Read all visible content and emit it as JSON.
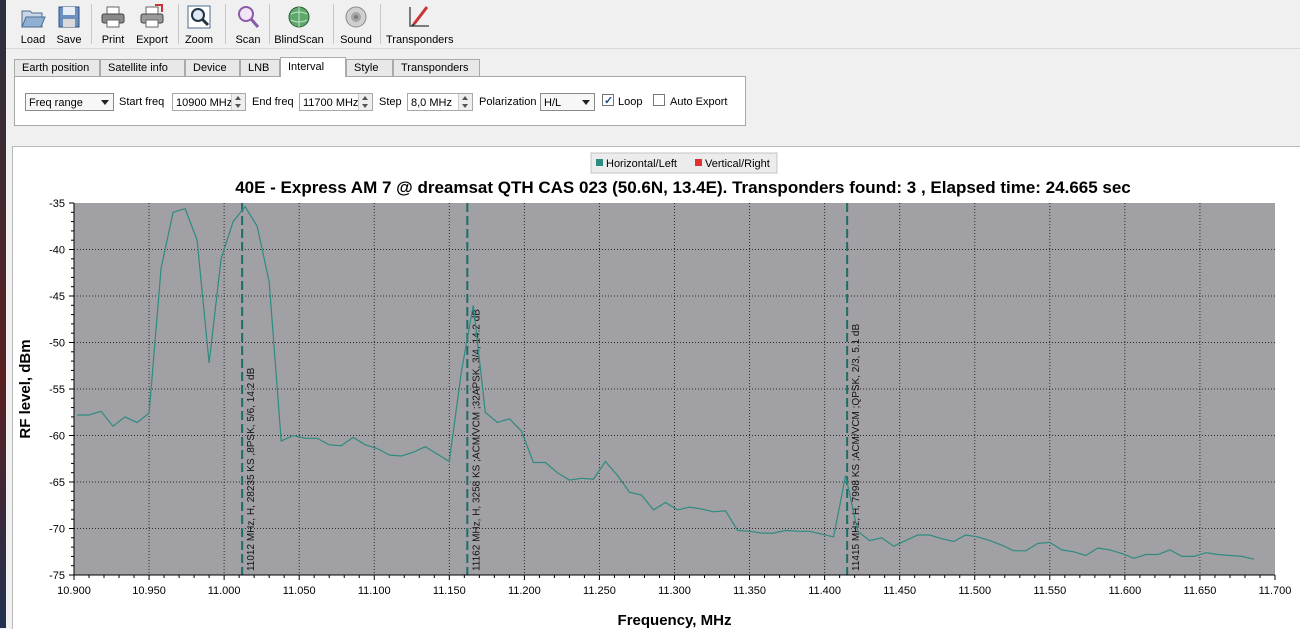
{
  "toolbar": {
    "buttons": [
      {
        "label": "Load",
        "icon": "folder-open-icon"
      },
      {
        "label": "Save",
        "icon": "floppy-disk-icon"
      },
      {
        "label": "Print",
        "icon": "printer-icon"
      },
      {
        "label": "Export",
        "icon": "export-printer-icon"
      },
      {
        "label": "Zoom",
        "icon": "magnifier-icon"
      },
      {
        "label": "Scan",
        "icon": "scan-magnifier-icon"
      },
      {
        "label": "BlindScan",
        "icon": "globe-icon"
      },
      {
        "label": "Sound",
        "icon": "speaker-icon"
      },
      {
        "label": "Transponders",
        "icon": "pencil-chart-icon"
      }
    ]
  },
  "tabs": [
    "Earth position",
    "Satellite info",
    "Device",
    "LNB",
    "Interval",
    "Style",
    "Transponders"
  ],
  "active_tab": "Interval",
  "interval": {
    "mode_select": "Freq range",
    "start_freq_label": "Start freq",
    "start_freq_value": "10900 MHz",
    "end_freq_label": "End freq",
    "end_freq_value": "11700 MHz",
    "step_label": "Step",
    "step_value": "8,0 MHz",
    "polarization_label": "Polarization",
    "polarization_value": "H/L",
    "loop_label": "Loop",
    "loop_checked": true,
    "auto_export_label": "Auto Export",
    "auto_export_checked": false
  },
  "chart_data": {
    "type": "line",
    "title": "40E - Express AM 7 @ dreamsat QTH CAS 023 (50.6N, 13.4E). Transponders found: 3 , Elapsed time: 24.665 sec",
    "xlabel": "Frequency, MHz",
    "ylabel": "RF level, dBm",
    "xlim": [
      10900,
      11700
    ],
    "ylim": [
      -75,
      -35
    ],
    "grid": true,
    "legend_position": "top-center",
    "x_ticks": [
      "10.900",
      "10.950",
      "11.000",
      "11.050",
      "11.100",
      "11.150",
      "11.200",
      "11.250",
      "11.300",
      "11.350",
      "11.400",
      "11.450",
      "11.500",
      "11.550",
      "11.600",
      "11.650",
      "11.700"
    ],
    "y_ticks": [
      "-35",
      "-40",
      "-45",
      "-50",
      "-55",
      "-60",
      "-65",
      "-70",
      "-75"
    ],
    "colors": {
      "plot_bg": "#a1a0a4",
      "horizontal": "#2e8b82",
      "vertical": "#e23030"
    },
    "series": [
      {
        "name": "Horizontal/Left",
        "color": "#2e8b82",
        "points": [
          [
            10902,
            -57.8
          ],
          [
            10910,
            -57.8
          ],
          [
            10918,
            -57.4
          ],
          [
            10926,
            -59.0
          ],
          [
            10934,
            -58.0
          ],
          [
            10942,
            -58.6
          ],
          [
            10950,
            -57.6
          ],
          [
            10958,
            -42.0
          ],
          [
            10966,
            -36.0
          ],
          [
            10974,
            -35.6
          ],
          [
            10982,
            -39.0
          ],
          [
            10990,
            -52.2
          ],
          [
            10998,
            -41.0
          ],
          [
            11006,
            -37.0
          ],
          [
            11014,
            -35.4
          ],
          [
            11022,
            -37.5
          ],
          [
            11030,
            -43.5
          ],
          [
            11038,
            -60.6
          ],
          [
            11046,
            -60.0
          ],
          [
            11054,
            -60.3
          ],
          [
            11062,
            -60.3
          ],
          [
            11070,
            -61.0
          ],
          [
            11078,
            -61.1
          ],
          [
            11086,
            -60.2
          ],
          [
            11094,
            -61.0
          ],
          [
            11102,
            -61.4
          ],
          [
            11110,
            -62.1
          ],
          [
            11118,
            -62.2
          ],
          [
            11126,
            -61.8
          ],
          [
            11134,
            -61.2
          ],
          [
            11142,
            -62.0
          ],
          [
            11150,
            -62.8
          ],
          [
            11158,
            -53.2
          ],
          [
            11166,
            -46.0
          ],
          [
            11174,
            -57.5
          ],
          [
            11182,
            -58.6
          ],
          [
            11190,
            -58.2
          ],
          [
            11198,
            -59.5
          ],
          [
            11206,
            -62.9
          ],
          [
            11214,
            -62.9
          ],
          [
            11222,
            -64.0
          ],
          [
            11230,
            -64.8
          ],
          [
            11238,
            -64.6
          ],
          [
            11246,
            -64.7
          ],
          [
            11254,
            -62.8
          ],
          [
            11262,
            -64.3
          ],
          [
            11270,
            -66.1
          ],
          [
            11278,
            -66.4
          ],
          [
            11286,
            -68.0
          ],
          [
            11294,
            -67.2
          ],
          [
            11302,
            -68.0
          ],
          [
            11310,
            -67.7
          ],
          [
            11318,
            -67.9
          ],
          [
            11326,
            -68.2
          ],
          [
            11334,
            -68.1
          ],
          [
            11342,
            -70.2
          ],
          [
            11350,
            -70.3
          ],
          [
            11358,
            -70.5
          ],
          [
            11366,
            -70.5
          ],
          [
            11374,
            -70.2
          ],
          [
            11382,
            -70.3
          ],
          [
            11390,
            -70.3
          ],
          [
            11398,
            -70.6
          ],
          [
            11406,
            -70.9
          ],
          [
            11414,
            -64.3
          ],
          [
            11422,
            -70.3
          ],
          [
            11430,
            -71.3
          ],
          [
            11438,
            -71.0
          ],
          [
            11446,
            -71.9
          ],
          [
            11454,
            -71.3
          ],
          [
            11462,
            -70.7
          ],
          [
            11470,
            -70.7
          ],
          [
            11478,
            -71.1
          ],
          [
            11486,
            -71.4
          ],
          [
            11494,
            -70.7
          ],
          [
            11502,
            -70.9
          ],
          [
            11510,
            -71.3
          ],
          [
            11518,
            -71.8
          ],
          [
            11526,
            -72.4
          ],
          [
            11534,
            -72.4
          ],
          [
            11542,
            -71.6
          ],
          [
            11550,
            -71.5
          ],
          [
            11558,
            -72.3
          ],
          [
            11566,
            -72.5
          ],
          [
            11574,
            -72.9
          ],
          [
            11582,
            -72.1
          ],
          [
            11590,
            -72.3
          ],
          [
            11598,
            -72.7
          ],
          [
            11606,
            -73.2
          ],
          [
            11614,
            -72.8
          ],
          [
            11622,
            -72.8
          ],
          [
            11630,
            -72.3
          ],
          [
            11638,
            -73.0
          ],
          [
            11646,
            -73.0
          ],
          [
            11654,
            -72.6
          ],
          [
            11662,
            -72.8
          ],
          [
            11670,
            -72.9
          ],
          [
            11678,
            -73.0
          ],
          [
            11686,
            -73.3
          ]
        ]
      },
      {
        "name": "Vertical/Right",
        "color": "#e23030",
        "points": []
      }
    ],
    "markers": [
      {
        "x": 11012,
        "label": "11012 MHz, H, 28235 KS ,8PSK, 5/6, 14.2 dB"
      },
      {
        "x": 11162,
        "label": "11162 MHz, H, 3258 KS ;ACM/VCM ;32APSK, 3/4, 14.2 dB"
      },
      {
        "x": 11415,
        "label": "11415 MHz, H, 7998 KS ;ACM/VCM ;QPSK, 2/3, 5.1 dB"
      }
    ]
  }
}
